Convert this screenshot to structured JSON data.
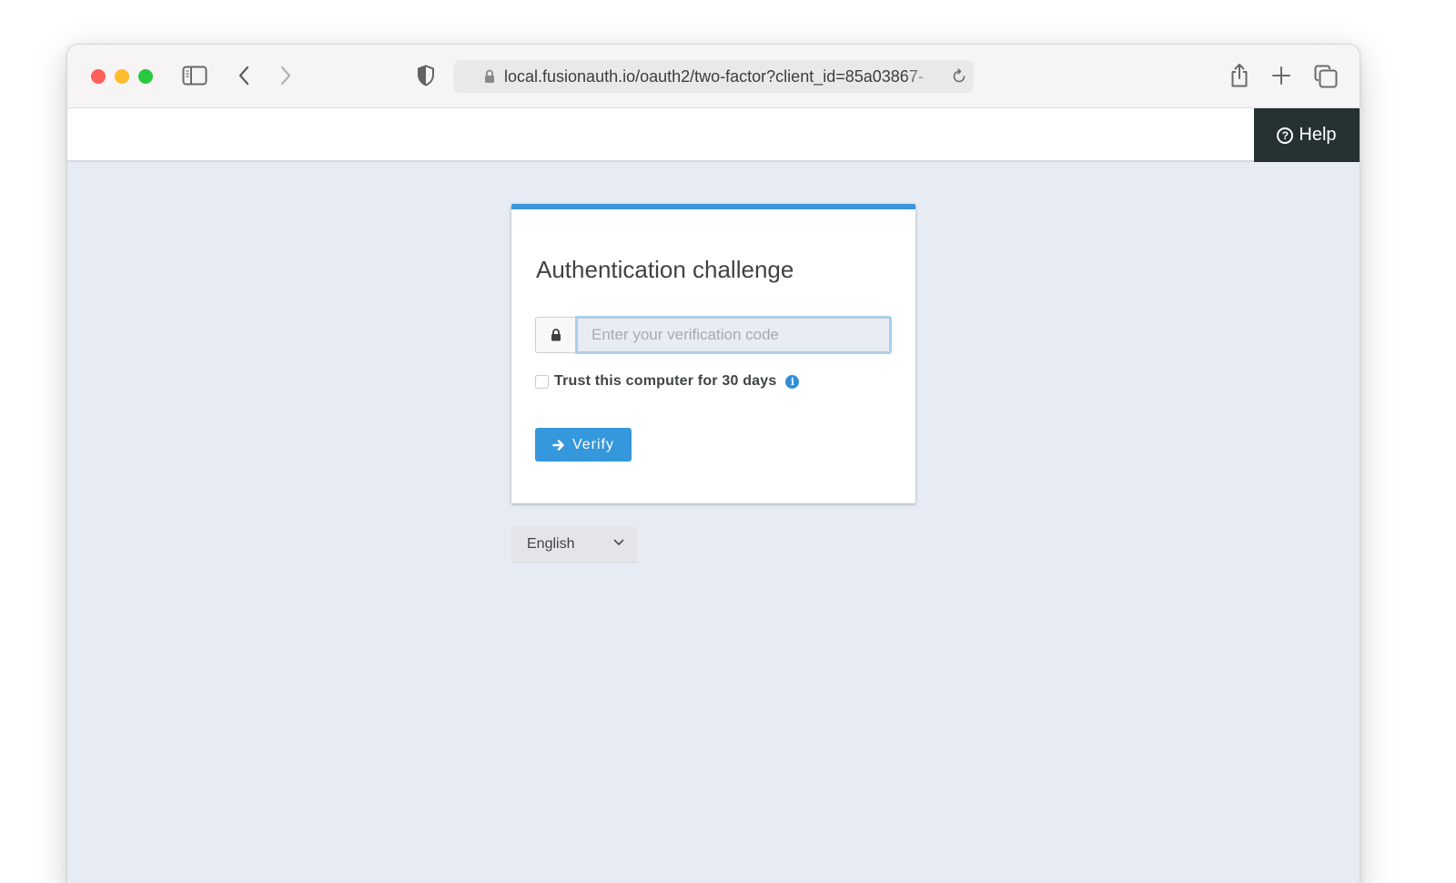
{
  "browser": {
    "url": "local.fusionauth.io/oauth2/two-factor?client_id=85a03867-",
    "icons": {
      "sidebar": "sidebar-icon",
      "back": "chevron-left-icon",
      "forward": "chevron-right-icon",
      "privacy": "shield-icon",
      "lock": "lock-icon",
      "reload": "reload-icon",
      "share": "share-icon",
      "new_tab": "plus-icon",
      "tabs": "tabs-overview-icon"
    }
  },
  "header": {
    "help_label": "Help"
  },
  "card": {
    "accent_color": "#3a96db",
    "title": "Authentication challenge",
    "code_input": {
      "value": "",
      "placeholder": "Enter your verification code"
    },
    "trust_checkbox": {
      "label": "Trust this computer for 30 days",
      "checked": false
    },
    "verify_label": "Verify"
  },
  "language": {
    "selected": "English"
  }
}
